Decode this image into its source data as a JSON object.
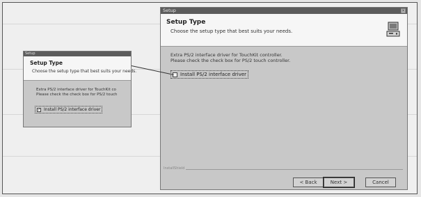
{
  "main_dialog": {
    "window_title": "Setup",
    "close_glyph": "×",
    "header_title": "Setup Type",
    "header_subtitle": "Choose the setup type that best suits your needs.",
    "header_icon": "setup-computer-icon",
    "description_line1": "Extra PS/2 interface driver for TouchKit controller.",
    "description_line2": "Please check the check box for PS/2 touch controller.",
    "checkbox_label": "Install PS/2 interface driver",
    "checkbox_checked": false,
    "footer_tag": "InstallShield",
    "buttons": {
      "back": "< Back",
      "next": "Next >",
      "cancel": "Cancel"
    }
  },
  "small_dialog": {
    "window_title": "Setup",
    "header_title": "Setup Type",
    "header_subtitle": "Choose the setup type that best suits your needs.",
    "description_line1": "Extra PS/2 interface driver for TouchKit co",
    "description_line2": "Please check the check box for PS/2 touch",
    "checkbox_label": "Install PS/2 interface driver",
    "checkbox_checked": true
  },
  "check_glyph": "✓"
}
